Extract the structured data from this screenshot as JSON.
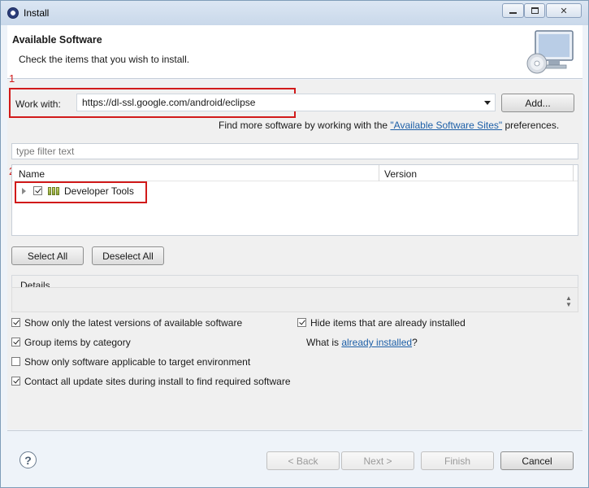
{
  "window": {
    "title": "Install"
  },
  "header": {
    "title": "Available Software",
    "description": "Check the items that you wish to install."
  },
  "annotations": {
    "marker1": "1",
    "marker2": "2"
  },
  "work_with": {
    "label": "Work with:",
    "value": "https://dl-ssl.google.com/android/eclipse",
    "add_button": "Add...",
    "find_more_prefix": "Find more software by working with the ",
    "find_more_link": "\"Available Software Sites\"",
    "find_more_suffix": " preferences."
  },
  "filter": {
    "placeholder": "type filter text"
  },
  "tree": {
    "columns": [
      "Name",
      "Version"
    ],
    "items": [
      {
        "label": "Developer Tools",
        "checked": true,
        "version": ""
      }
    ]
  },
  "selection_buttons": {
    "select_all": "Select All",
    "deselect_all": "Deselect All"
  },
  "details": {
    "label": "Details"
  },
  "options": {
    "show_latest": {
      "label": "Show only the latest versions of available software",
      "checked": true
    },
    "group_by_category": {
      "label": "Group items by category",
      "checked": true
    },
    "show_applicable": {
      "label": "Show only software applicable to target environment",
      "checked": false
    },
    "contact_sites": {
      "label": "Contact all update sites during install to find required software",
      "checked": true
    },
    "hide_installed": {
      "label": "Hide items that are already installed",
      "checked": true
    },
    "what_is_prefix": "What is ",
    "what_is_link": "already installed",
    "what_is_suffix": "?"
  },
  "footer": {
    "help": "?",
    "back": "< Back",
    "next": "Next >",
    "finish": "Finish",
    "cancel": "Cancel"
  },
  "colors": {
    "annotation_red": "#d11a1a",
    "link_blue": "#1d5fa7"
  }
}
